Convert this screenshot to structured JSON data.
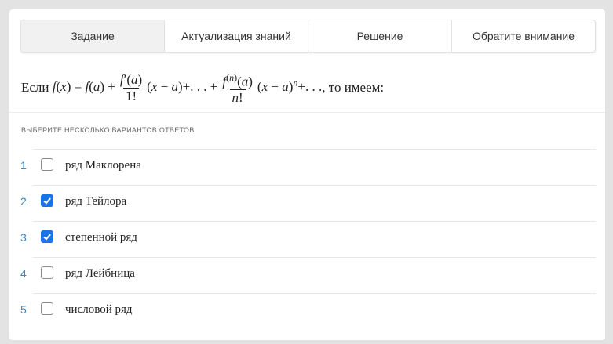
{
  "tabs": [
    {
      "label": "Задание",
      "active": true
    },
    {
      "label": "Актуализация знаний",
      "active": false
    },
    {
      "label": "Решение",
      "active": false
    },
    {
      "label": "Обратите внимание",
      "active": false
    }
  ],
  "question": {
    "prefix": "Если",
    "suffix": ", то имеем:"
  },
  "hint": "ВЫБЕРИТЕ НЕСКОЛЬКО ВАРИАНТОВ ОТВЕТОВ",
  "options": [
    {
      "number": "1",
      "label": "ряд Маклорена",
      "checked": false
    },
    {
      "number": "2",
      "label": "ряд Тейлора",
      "checked": true
    },
    {
      "number": "3",
      "label": "степенной ряд",
      "checked": true
    },
    {
      "number": "4",
      "label": "ряд Лейбница",
      "checked": false
    },
    {
      "number": "5",
      "label": "числовой ряд",
      "checked": false
    }
  ],
  "colors": {
    "accent": "#1a73e8",
    "number": "#3a86c8",
    "background": "#e3e3e3"
  }
}
